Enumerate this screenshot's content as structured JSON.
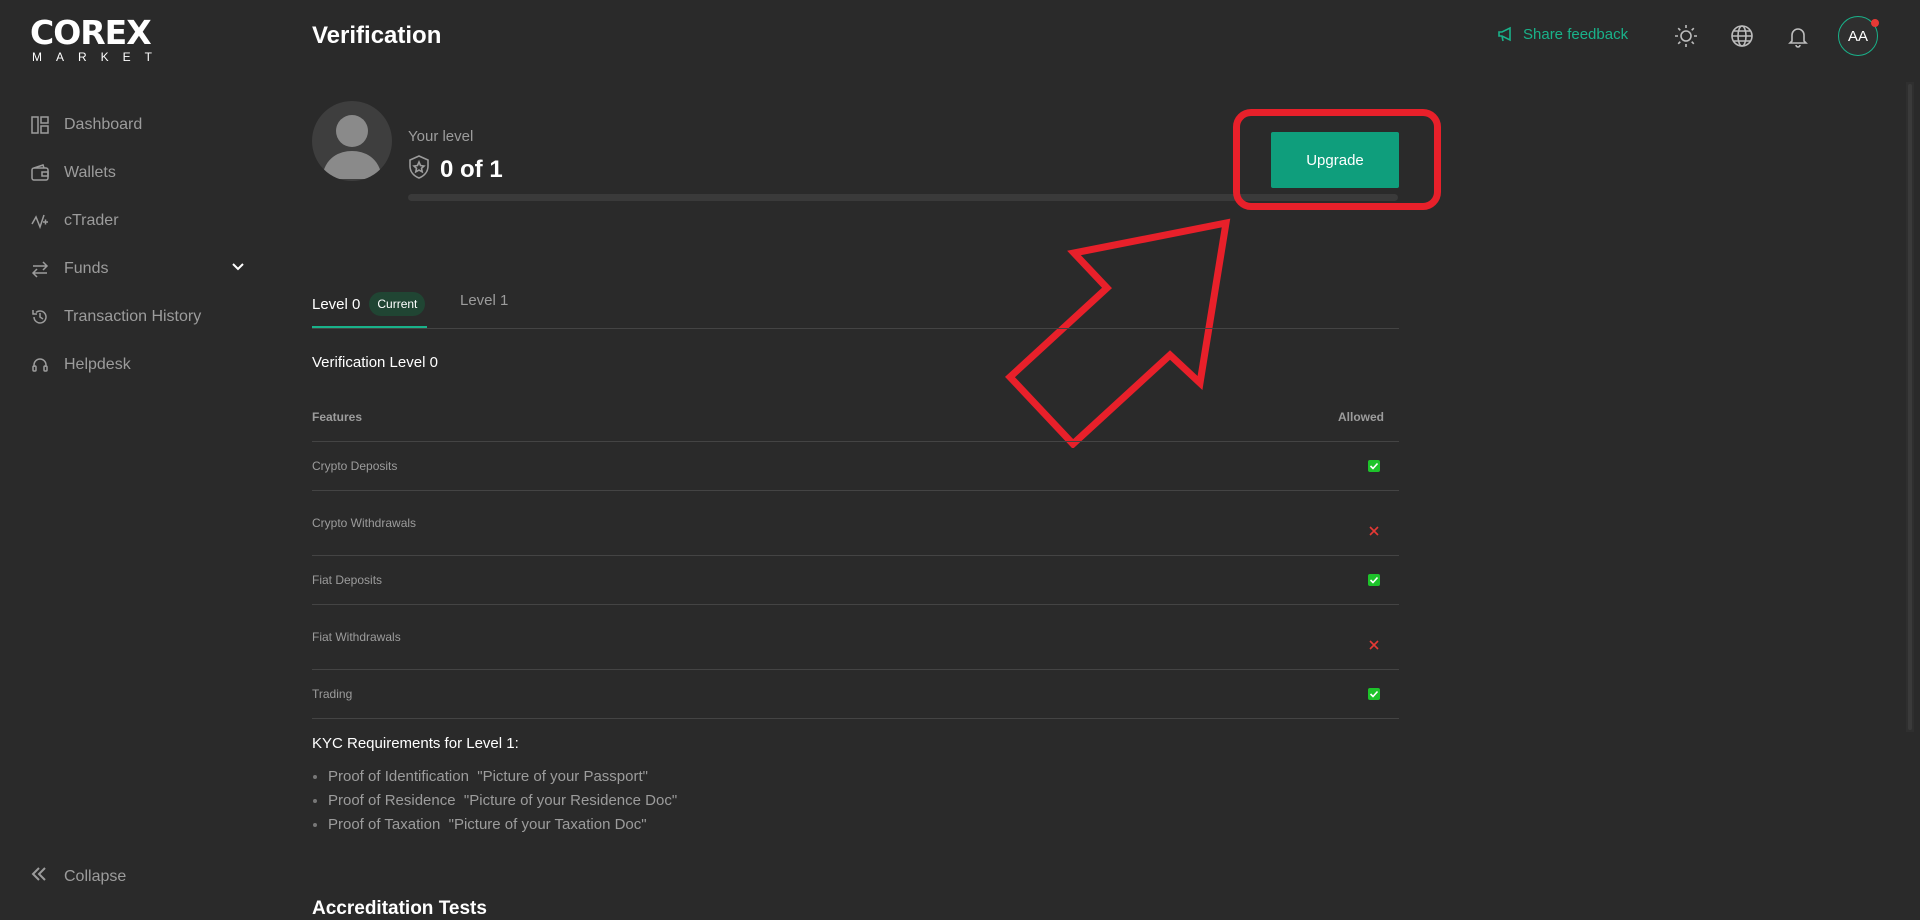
{
  "app": {
    "logo_top": "COREX",
    "logo_bottom": "MARKET"
  },
  "sidebar": {
    "items": [
      {
        "label": "Dashboard",
        "icon": "dashboard-icon"
      },
      {
        "label": "Wallets",
        "icon": "wallet-icon"
      },
      {
        "label": "cTrader",
        "icon": "ctrader-icon"
      },
      {
        "label": "Funds",
        "icon": "transfer-icon"
      },
      {
        "label": "Transaction History",
        "icon": "history-icon"
      },
      {
        "label": "Helpdesk",
        "icon": "headset-icon"
      }
    ],
    "collapse_label": "Collapse"
  },
  "header": {
    "title": "Verification",
    "feedback_label": "Share feedback",
    "avatar_initials": "AA"
  },
  "level": {
    "your_level_label": "Your level",
    "value": "0 of 1",
    "progress_fraction": 0,
    "upgrade_label": "Upgrade"
  },
  "tabs": [
    {
      "label": "Level 0",
      "badge": "Current"
    },
    {
      "label": "Level 1"
    }
  ],
  "table": {
    "section_title": "Verification Level 0",
    "col_features": "Features",
    "col_allowed": "Allowed",
    "rows": [
      {
        "feature": "Crypto Deposits",
        "allowed": true
      },
      {
        "feature": "Crypto Withdrawals",
        "allowed": false
      },
      {
        "feature": "Fiat Deposits",
        "allowed": true
      },
      {
        "feature": "Fiat Withdrawals",
        "allowed": false
      },
      {
        "feature": "Trading",
        "allowed": true
      }
    ]
  },
  "kyc": {
    "title": "KYC Requirements for Level 1:",
    "items": [
      "Proof of Identification  \"Picture of your Passport\"",
      "Proof of Residence  \"Picture of your Residence Doc\"",
      "Proof of Taxation  \"Picture of your Taxation Doc\""
    ]
  },
  "accreditation": {
    "title": "Accreditation Tests"
  },
  "colors": {
    "accent": "#19b28a",
    "annotation": "#e8202a",
    "allowed": "#1dc32a",
    "denied": "#e53935"
  }
}
